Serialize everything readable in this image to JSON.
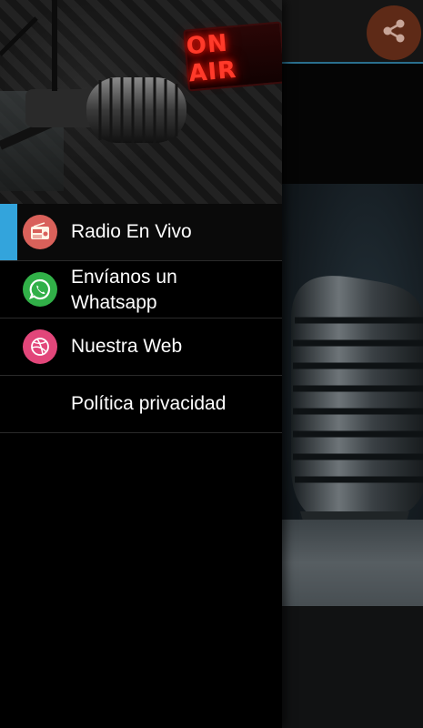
{
  "header": {
    "on_air_text": "ON AIR"
  },
  "toolbar": {
    "share_icon": "share-icon"
  },
  "menu": {
    "items": [
      {
        "label": "Radio En Vivo",
        "icon": "radio-icon",
        "color": "#d9615a",
        "active": true
      },
      {
        "label": "Envíanos un\nWhatsapp",
        "icon": "whatsapp-icon",
        "color": "#31b048",
        "active": false
      },
      {
        "label": "Nuestra Web",
        "icon": "dribbble-icon",
        "color": "#e2467a",
        "active": false
      },
      {
        "label": "Política privacidad",
        "icon": "",
        "color": "",
        "active": false
      }
    ]
  },
  "colors": {
    "accent": "#33a4dc",
    "share_bg": "#5e2a17",
    "toolbar_line": "#2a6f8e"
  }
}
